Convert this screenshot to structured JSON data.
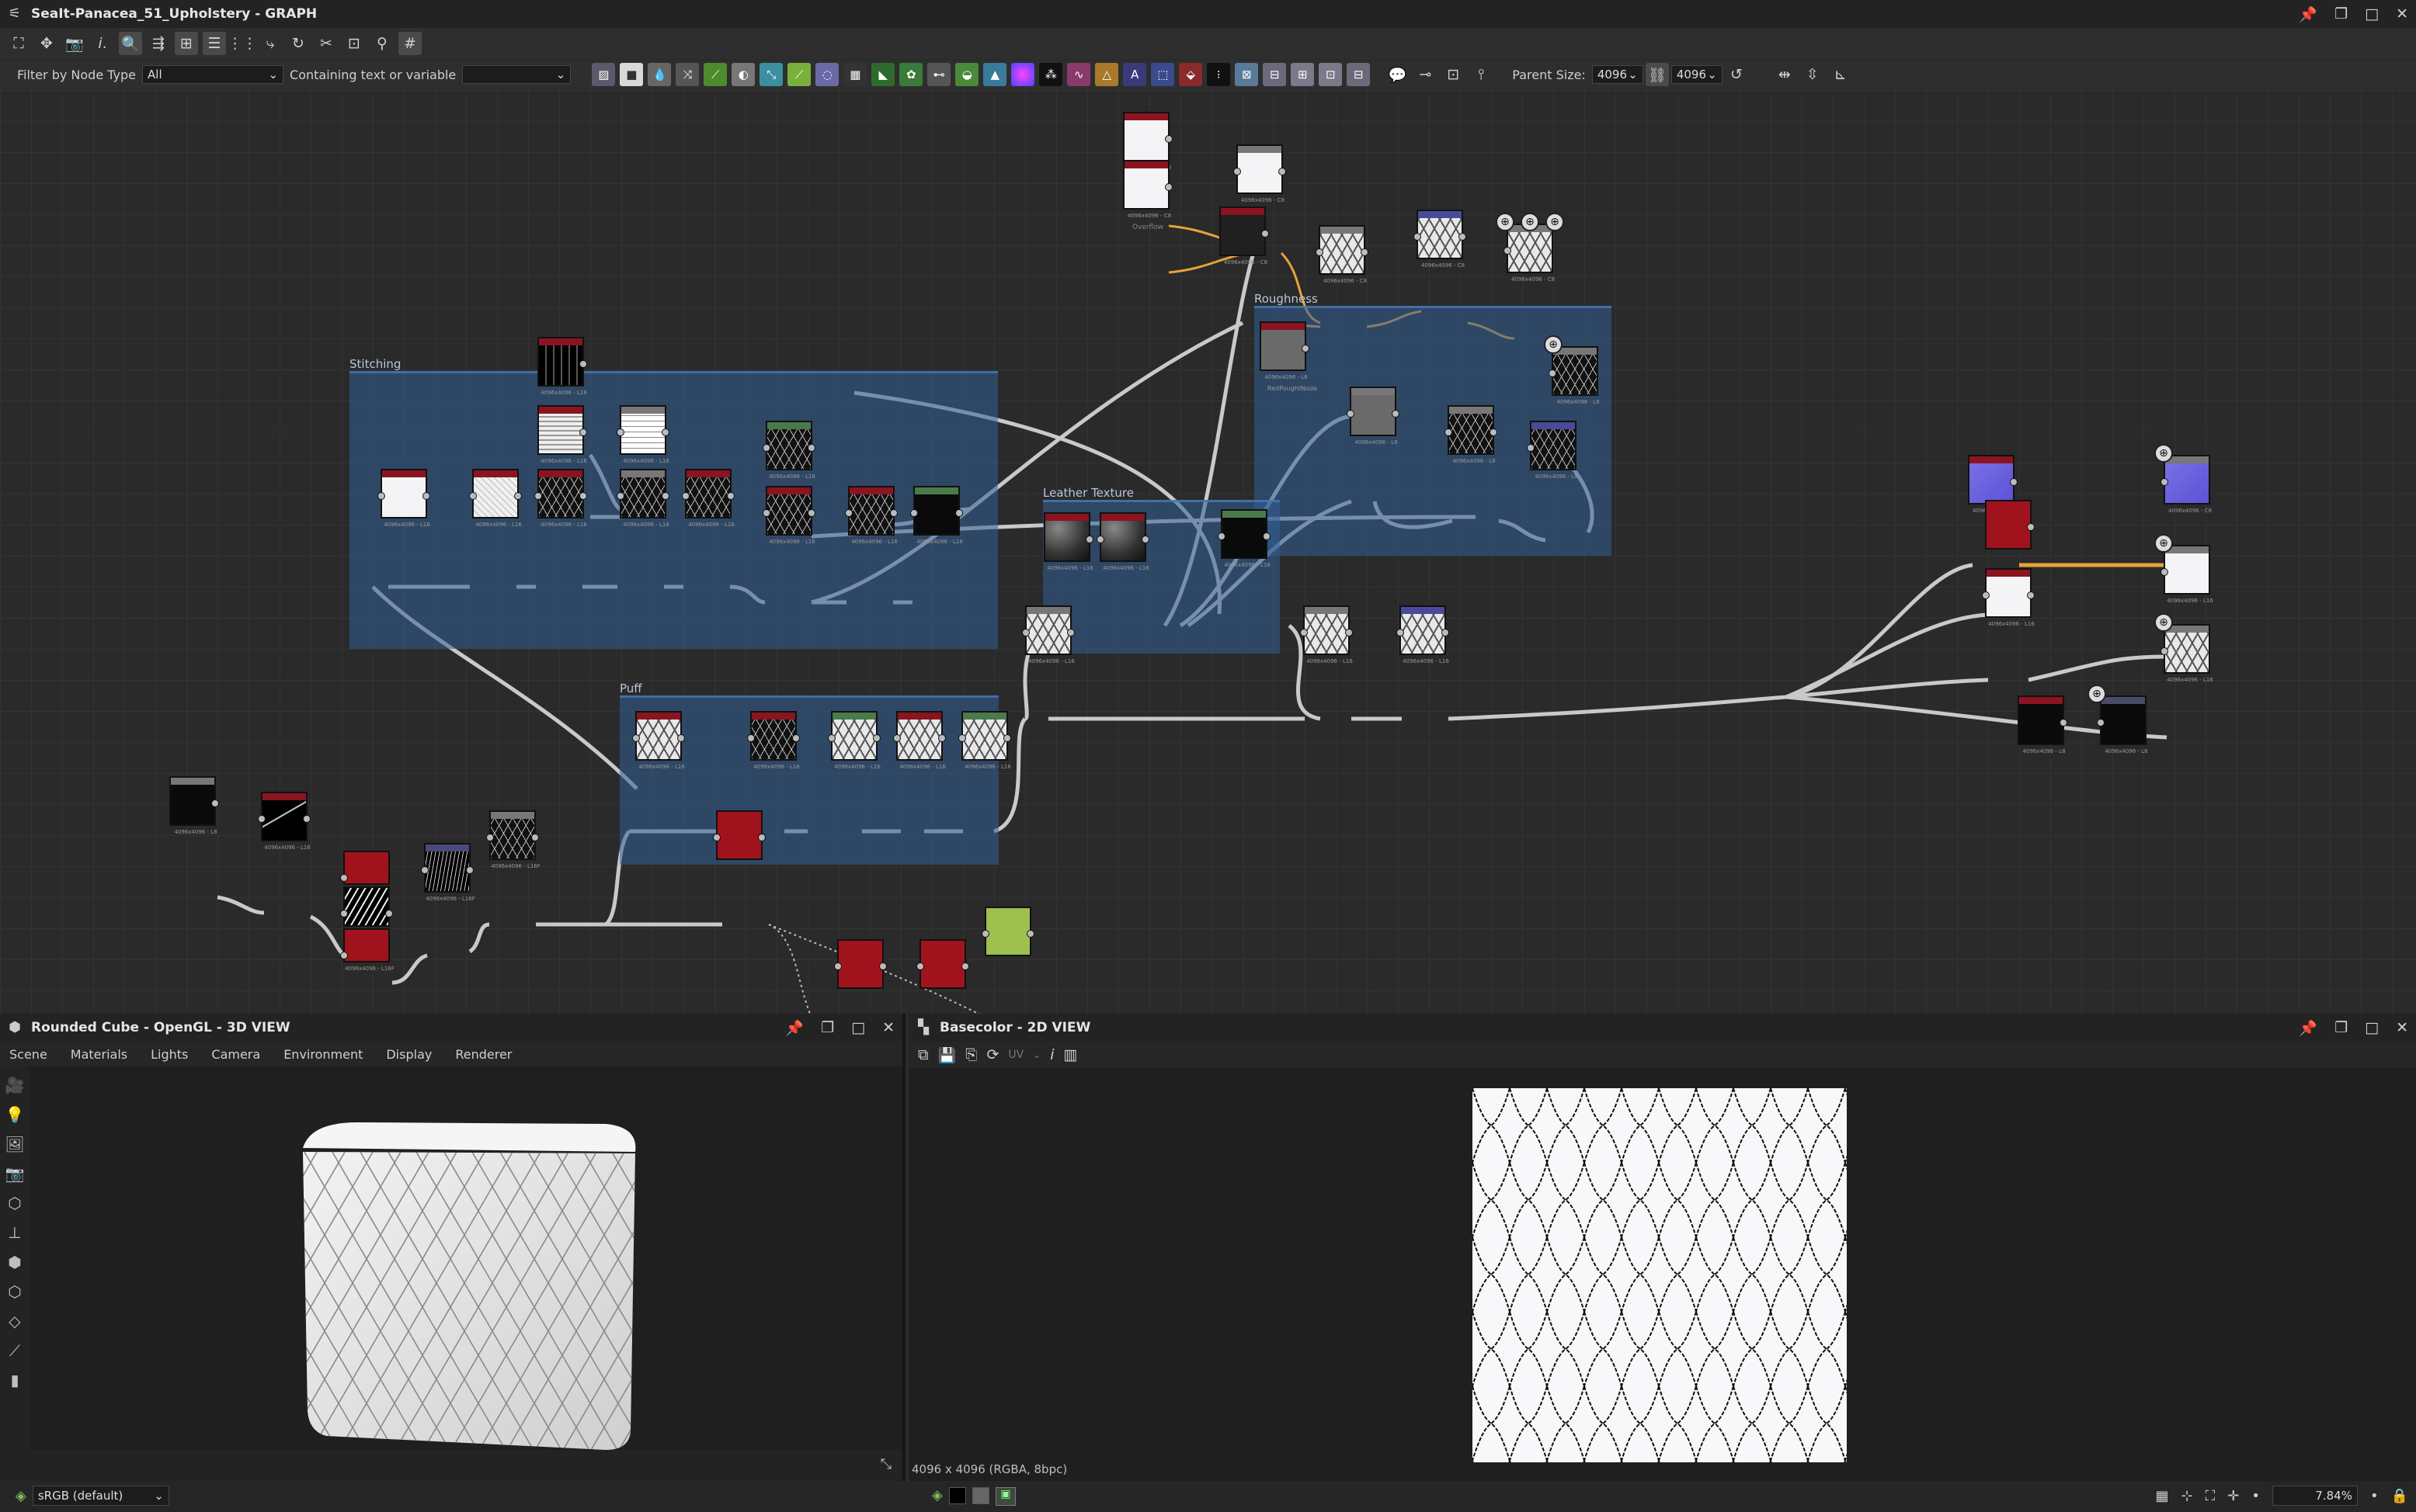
{
  "window": {
    "title": "SeaIt-Panacea_51_Upholstery - GRAPH",
    "controls": [
      "pin-icon",
      "restore-icon",
      "maximize-icon",
      "close-icon"
    ]
  },
  "filter_bar": {
    "filter_label": "Filter by Node Type",
    "filter_value": "All",
    "contains_label": "Containing text or variable",
    "contains_value": "",
    "parent_size_label": "Parent Size:",
    "parent_size_w": "4096",
    "parent_size_h": "4096"
  },
  "frames": {
    "stitching": "Stitching",
    "roughness": "Roughness",
    "leather": "Leather Texture",
    "puff": "Puff"
  },
  "node_captions": {
    "std": "4096x4096 - L16",
    "c8": "4096x4096 - C8",
    "l8": "4096x4096 - L8",
    "l16f": "4096x4096 - L16F",
    "overflow_label": "Overflow",
    "roughness_caption": "RedPoughtNode"
  },
  "panel3d": {
    "title": "Rounded Cube - OpenGL - 3D VIEW",
    "menu": [
      "Scene",
      "Materials",
      "Lights",
      "Camera",
      "Environment",
      "Display",
      "Renderer"
    ],
    "colorspace": "sRGB (default)"
  },
  "panel2d": {
    "title": "Basecolor - 2D VIEW",
    "uv_label": "UV",
    "resolution_info": "4096 x 4096 (RGBA, 8bpc)",
    "zoom": "7.84%"
  }
}
